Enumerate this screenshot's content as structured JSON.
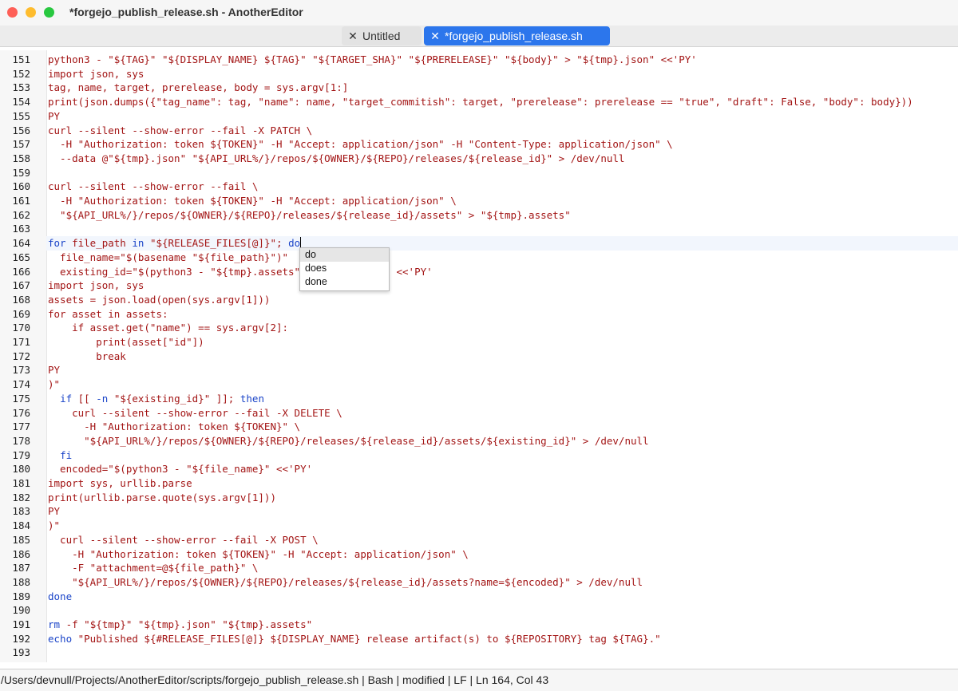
{
  "window": {
    "title": "*forgejo_publish_release.sh - AnotherEditor",
    "traffic_lights": {
      "close": "#fe5f57",
      "minimize": "#febc2e",
      "zoom": "#28c840"
    }
  },
  "tabs": [
    {
      "label": "Untitled",
      "active": false,
      "close_glyph": "✕"
    },
    {
      "label": "*forgejo_publish_release.sh",
      "active": true,
      "close_glyph": "✕"
    }
  ],
  "editor": {
    "current_line": 164,
    "lines": [
      {
        "n": "151",
        "segs": [
          {
            "t": "python3 - \"${TAG}\" \"${DISPLAY_NAME} ${TAG}\" \"${TARGET_SHA}\" \"${PRERELEASE}\" \"${body}\" > \"${tmp}.json\" <<'PY'"
          }
        ]
      },
      {
        "n": "152",
        "segs": [
          {
            "t": "import json, sys"
          }
        ]
      },
      {
        "n": "153",
        "segs": [
          {
            "t": "tag, name, target, prerelease, body = sys.argv[1:]"
          }
        ]
      },
      {
        "n": "154",
        "segs": [
          {
            "t": "print(json.dumps({\"tag_name\": tag, \"name\": name, \"target_commitish\": target, \"prerelease\": prerelease == \"true\", \"draft\": False, \"body\": body}))"
          }
        ]
      },
      {
        "n": "155",
        "segs": [
          {
            "t": "PY"
          }
        ]
      },
      {
        "n": "156",
        "segs": [
          {
            "t": "curl --silent --show-error --fail -X PATCH \\"
          }
        ]
      },
      {
        "n": "157",
        "segs": [
          {
            "t": "  -H \"Authorization: token ${TOKEN}\" -H \"Accept: application/json\" -H \"Content-Type: application/json\" \\"
          }
        ]
      },
      {
        "n": "158",
        "segs": [
          {
            "t": "  --data @\"${tmp}.json\" \"${API_URL%/}/repos/${OWNER}/${REPO}/releases/${release_id}\" > /dev/null"
          }
        ]
      },
      {
        "n": "159",
        "segs": [
          {
            "t": ""
          }
        ]
      },
      {
        "n": "160",
        "segs": [
          {
            "t": "curl --silent --show-error --fail \\"
          }
        ]
      },
      {
        "n": "161",
        "segs": [
          {
            "t": "  -H \"Authorization: token ${TOKEN}\" -H \"Accept: application/json\" \\"
          }
        ]
      },
      {
        "n": "162",
        "segs": [
          {
            "t": "  \"${API_URL%/}/repos/${OWNER}/${REPO}/releases/${release_id}/assets\" > \"${tmp}.assets\""
          }
        ]
      },
      {
        "n": "163",
        "segs": [
          {
            "t": ""
          }
        ]
      },
      {
        "n": "164",
        "segs": [
          {
            "t": "for",
            "k": 1
          },
          {
            "t": " file_path "
          },
          {
            "t": "in",
            "k": 1
          },
          {
            "t": " \"${RELEASE_FILES[@]}\"; "
          },
          {
            "t": "do",
            "k": 1
          }
        ]
      },
      {
        "n": "165",
        "segs": [
          {
            "t": "  file_name=\"$(basename \"${file_path}\")\""
          }
        ]
      },
      {
        "n": "166",
        "segs": [
          {
            "t": "  existing_id=\"$(python3 - \"${tmp}.assets\" \"${file_name}\" <<'PY'"
          }
        ]
      },
      {
        "n": "167",
        "segs": [
          {
            "t": "import json, sys"
          }
        ]
      },
      {
        "n": "168",
        "segs": [
          {
            "t": "assets = json.load(open(sys.argv[1]))"
          }
        ]
      },
      {
        "n": "169",
        "segs": [
          {
            "t": "for asset in assets:"
          }
        ]
      },
      {
        "n": "170",
        "segs": [
          {
            "t": "    if asset.get(\"name\") == sys.argv[2]:"
          }
        ]
      },
      {
        "n": "171",
        "segs": [
          {
            "t": "        print(asset[\"id\"])"
          }
        ]
      },
      {
        "n": "172",
        "segs": [
          {
            "t": "        break"
          }
        ]
      },
      {
        "n": "173",
        "segs": [
          {
            "t": "PY"
          }
        ]
      },
      {
        "n": "174",
        "segs": [
          {
            "t": ")\""
          }
        ]
      },
      {
        "n": "175",
        "segs": [
          {
            "t": "  "
          },
          {
            "t": "if",
            "k": 1
          },
          {
            "t": " [[ "
          },
          {
            "t": "-n",
            "k": 1
          },
          {
            "t": " \"${existing_id}\" ]]; "
          },
          {
            "t": "then",
            "k": 1
          }
        ]
      },
      {
        "n": "176",
        "segs": [
          {
            "t": "    curl --silent --show-error --fail -X DELETE \\"
          }
        ]
      },
      {
        "n": "177",
        "segs": [
          {
            "t": "      -H \"Authorization: token ${TOKEN}\" \\"
          }
        ]
      },
      {
        "n": "178",
        "segs": [
          {
            "t": "      \"${API_URL%/}/repos/${OWNER}/${REPO}/releases/${release_id}/assets/${existing_id}\" > /dev/null"
          }
        ]
      },
      {
        "n": "179",
        "segs": [
          {
            "t": "  "
          },
          {
            "t": "fi",
            "k": 1
          }
        ]
      },
      {
        "n": "180",
        "segs": [
          {
            "t": "  encoded=\"$(python3 - \"${file_name}\" <<'PY'"
          }
        ]
      },
      {
        "n": "181",
        "segs": [
          {
            "t": "import sys, urllib.parse"
          }
        ]
      },
      {
        "n": "182",
        "segs": [
          {
            "t": "print(urllib.parse.quote(sys.argv[1]))"
          }
        ]
      },
      {
        "n": "183",
        "segs": [
          {
            "t": "PY"
          }
        ]
      },
      {
        "n": "184",
        "segs": [
          {
            "t": ")\""
          }
        ]
      },
      {
        "n": "185",
        "segs": [
          {
            "t": "  curl --silent --show-error --fail -X POST \\"
          }
        ]
      },
      {
        "n": "186",
        "segs": [
          {
            "t": "    -H \"Authorization: token ${TOKEN}\" -H \"Accept: application/json\" \\"
          }
        ]
      },
      {
        "n": "187",
        "segs": [
          {
            "t": "    -F \"attachment=@${file_path}\" \\"
          }
        ]
      },
      {
        "n": "188",
        "segs": [
          {
            "t": "    \"${API_URL%/}/repos/${OWNER}/${REPO}/releases/${release_id}/assets?name=${encoded}\" > /dev/null"
          }
        ]
      },
      {
        "n": "189",
        "segs": [
          {
            "t": "done",
            "k": 1
          }
        ]
      },
      {
        "n": "190",
        "segs": [
          {
            "t": ""
          }
        ]
      },
      {
        "n": "191",
        "segs": [
          {
            "t": "rm",
            "k": 1
          },
          {
            "t": " -f \"${tmp}\" \"${tmp}.json\" \"${tmp}.assets\""
          }
        ]
      },
      {
        "n": "192",
        "segs": [
          {
            "t": "echo",
            "k": 1
          },
          {
            "t": " \"Published ${#RELEASE_FILES[@]} ${DISPLAY_NAME} release artifact(s) to ${REPOSITORY} tag ${TAG}.\""
          }
        ]
      },
      {
        "n": "193",
        "segs": [
          {
            "t": ""
          }
        ]
      }
    ]
  },
  "autocomplete": {
    "items": [
      "do",
      "does",
      "done"
    ],
    "selected_index": 0
  },
  "colors": {
    "string_text": "#a31515",
    "keyword": "#1a44c8",
    "active_tab": "#2c76ec"
  },
  "status_bar": {
    "text": "/Users/devnull/Projects/AnotherEditor/scripts/forgejo_publish_release.sh | Bash | modified | LF | Ln 164, Col 43"
  }
}
